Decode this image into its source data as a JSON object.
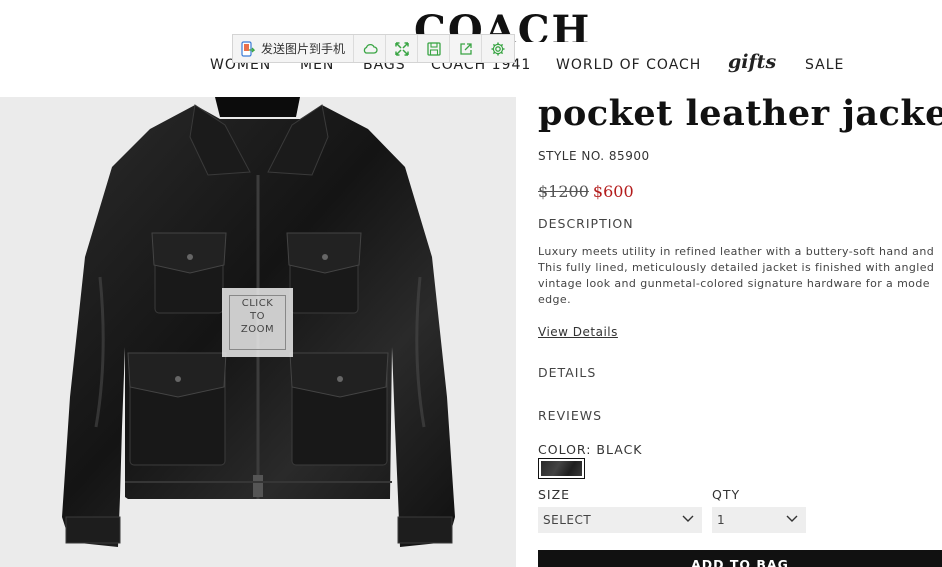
{
  "brand": {
    "logo_text": "COACH"
  },
  "nav": {
    "items": [
      "WOMEN",
      "MEN",
      "BAGS",
      "COACH 1941",
      "WORLD OF COACH",
      "gifts",
      "SALE"
    ]
  },
  "share_toolbar": {
    "send_label": "发送图片到手机",
    "icons": [
      "phone-send-icon",
      "cloud-icon",
      "expand-icon",
      "save-icon",
      "share-icon",
      "settings-icon"
    ]
  },
  "product": {
    "title": "pocket leather jacket",
    "style_no": "STYLE NO. 85900",
    "price_original": "$1200",
    "price_sale": "$600",
    "description_label": "DESCRIPTION",
    "description_lines": [
      "Luxury meets utility in refined leather with a buttery-soft hand and",
      "This fully lined, meticulously detailed jacket is finished with angled",
      "vintage look and gunmetal-colored signature hardware for a mode",
      "edge."
    ],
    "view_details": "View Details",
    "details_label": "DETAILS",
    "reviews_label": "REVIEWS",
    "color_label": "COLOR: BLACK",
    "size_label": "SIZE",
    "size_value": "SELECT",
    "qty_label": "QTY",
    "qty_value": "1",
    "add_to_bag": "ADD TO BAG",
    "zoom_text": [
      "CLICK",
      "TO",
      "ZOOM"
    ]
  },
  "colors": {
    "sale_price": "#b31b1b",
    "image_bg": "#ebebeb",
    "button_bg": "#111111",
    "toolbar_icon": "#3aa544"
  }
}
